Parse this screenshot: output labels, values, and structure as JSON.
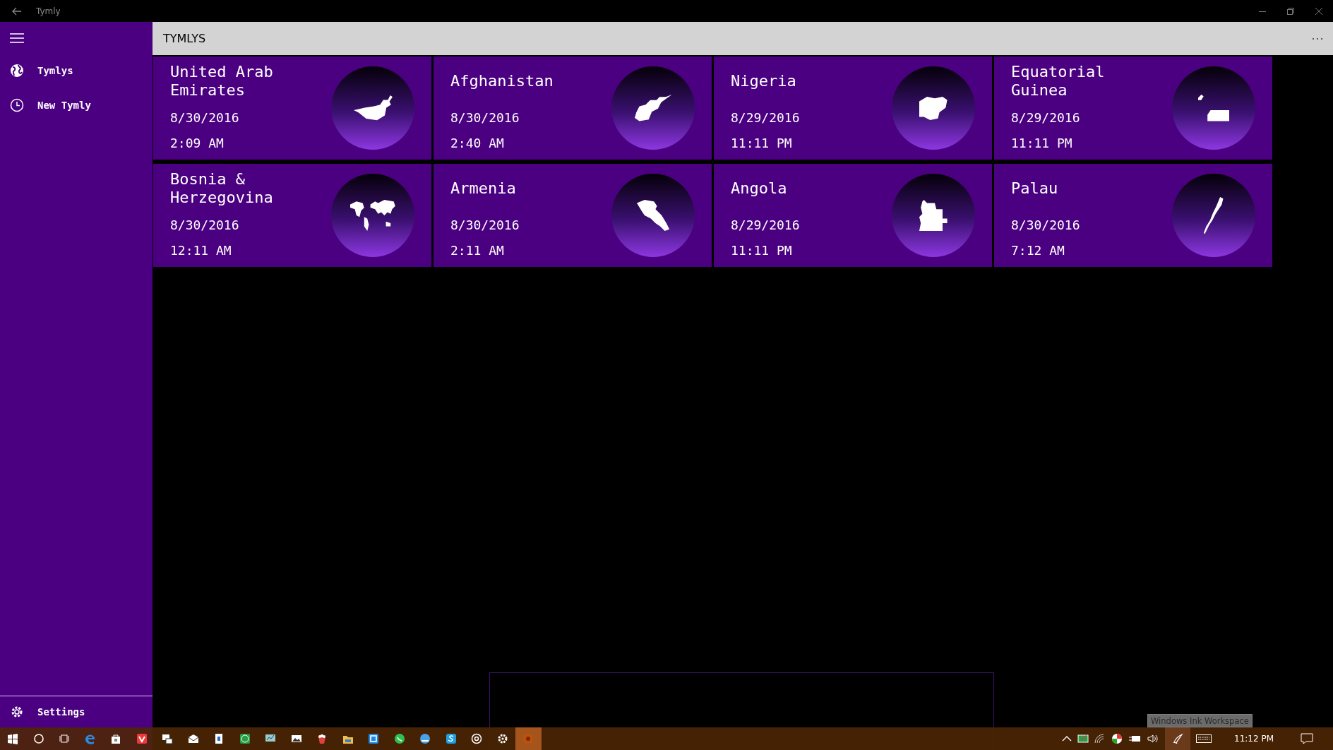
{
  "window": {
    "title": "Tymly"
  },
  "sidebar": {
    "items": [
      {
        "label": "Tymlys"
      },
      {
        "label": "New Tymly"
      }
    ],
    "footer": {
      "label": "Settings"
    }
  },
  "header": {
    "title": "TYMLYS"
  },
  "cards": [
    {
      "name": "United Arab Emirates",
      "date": "8/30/2016",
      "time": "2:09 AM"
    },
    {
      "name": "Afghanistan",
      "date": "8/30/2016",
      "time": "2:40 AM"
    },
    {
      "name": "Nigeria",
      "date": "8/29/2016",
      "time": "11:11 PM"
    },
    {
      "name": "Equatorial Guinea",
      "date": "8/29/2016",
      "time": "11:11 PM"
    },
    {
      "name": "Bosnia & Herzegovina",
      "date": "8/30/2016",
      "time": "12:11 AM"
    },
    {
      "name": "Armenia",
      "date": "8/30/2016",
      "time": "2:11 AM"
    },
    {
      "name": "Angola",
      "date": "8/29/2016",
      "time": "11:11 PM"
    },
    {
      "name": "Palau",
      "date": "8/30/2016",
      "time": "7:12 AM"
    }
  ],
  "taskbar": {
    "tooltip": "Windows Ink Workspace",
    "clock": "11:12 PM"
  }
}
